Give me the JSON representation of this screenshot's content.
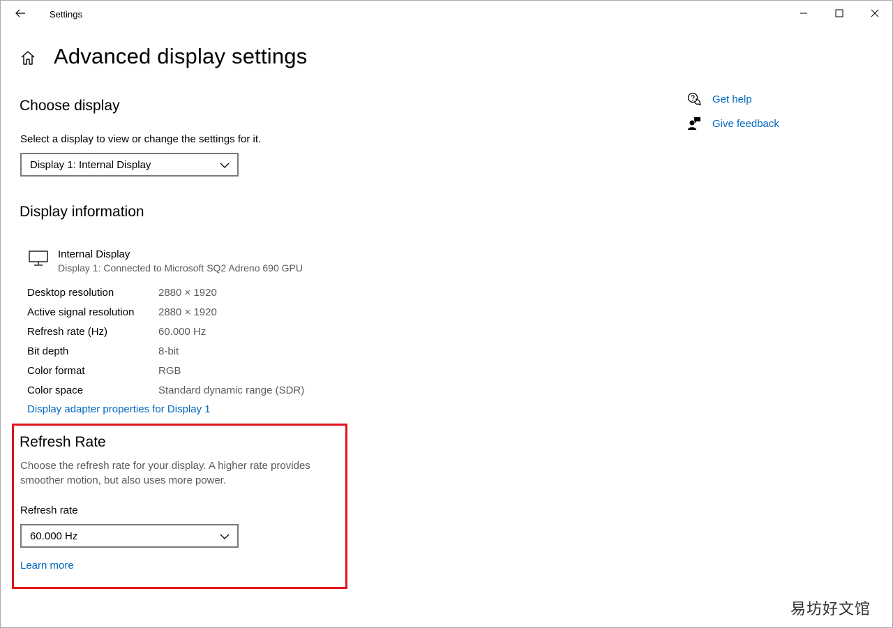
{
  "titlebar": {
    "app_title": "Settings"
  },
  "page": {
    "title": "Advanced display settings"
  },
  "choose_display": {
    "heading": "Choose display",
    "description": "Select a display to view or change the settings for it.",
    "selected_display": "Display 1: Internal Display"
  },
  "display_info": {
    "heading": "Display information",
    "monitor_name": "Internal Display",
    "monitor_detail": "Display 1: Connected to Microsoft SQ2 Adreno 690 GPU",
    "rows": [
      {
        "label": "Desktop resolution",
        "value": "2880 × 1920"
      },
      {
        "label": "Active signal resolution",
        "value": "2880 × 1920"
      },
      {
        "label": "Refresh rate (Hz)",
        "value": "60.000 Hz"
      },
      {
        "label": "Bit depth",
        "value": "8-bit"
      },
      {
        "label": "Color format",
        "value": "RGB"
      },
      {
        "label": "Color space",
        "value": "Standard dynamic range (SDR)"
      }
    ],
    "adapter_link": "Display adapter properties for Display 1"
  },
  "refresh_rate": {
    "heading": "Refresh Rate",
    "description_line1": "Choose the refresh rate for your display. A higher rate provides",
    "description_line2": "smoother motion, but also uses more power.",
    "field_label": "Refresh rate",
    "selected_value": "60.000 Hz",
    "learn_more": "Learn more"
  },
  "side_help": {
    "get_help": "Get help",
    "give_feedback": "Give feedback"
  },
  "watermark": "易坊好文馆",
  "colors": {
    "link": "#0067c0",
    "highlight": "#e0131b",
    "muted_text": "#5a5a5a"
  }
}
